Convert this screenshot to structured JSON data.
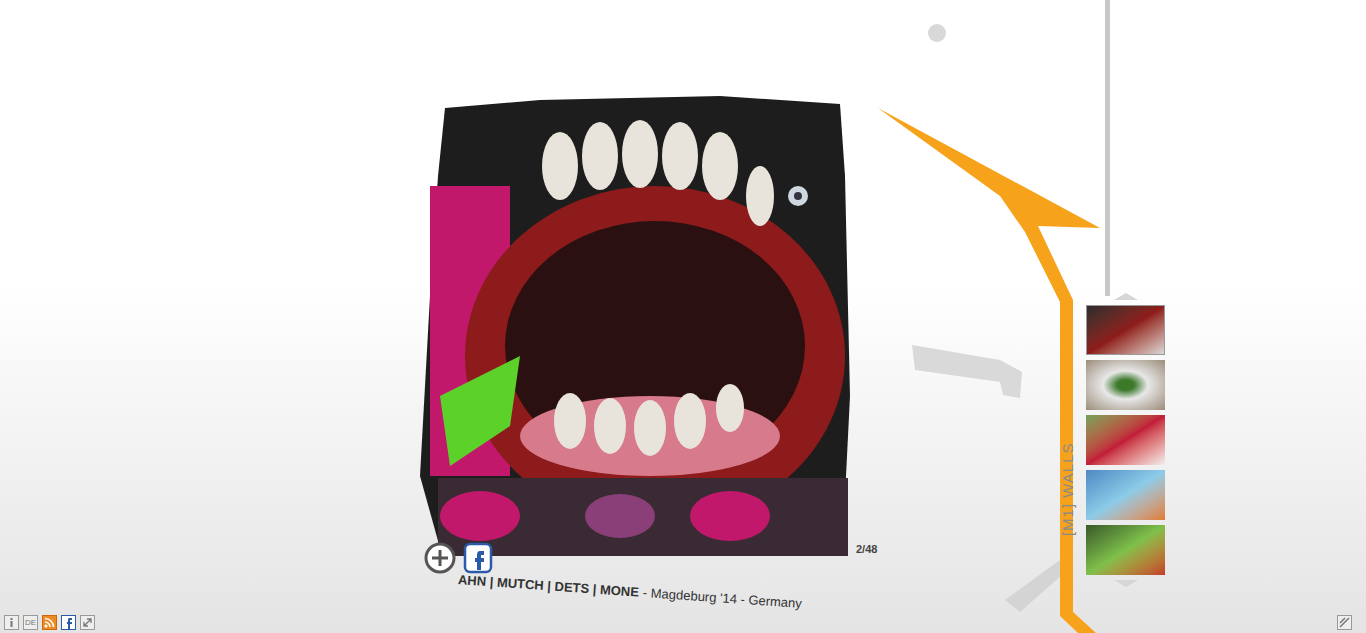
{
  "gallery": {
    "counter": "2/48",
    "caption": {
      "artists": "AHN | MUTCH | DETS | MONE",
      "details": "- Magdeburg '14 - Germany"
    }
  },
  "section": {
    "label": "[M1] WALLS"
  },
  "toolbar": {
    "language": "DE"
  }
}
